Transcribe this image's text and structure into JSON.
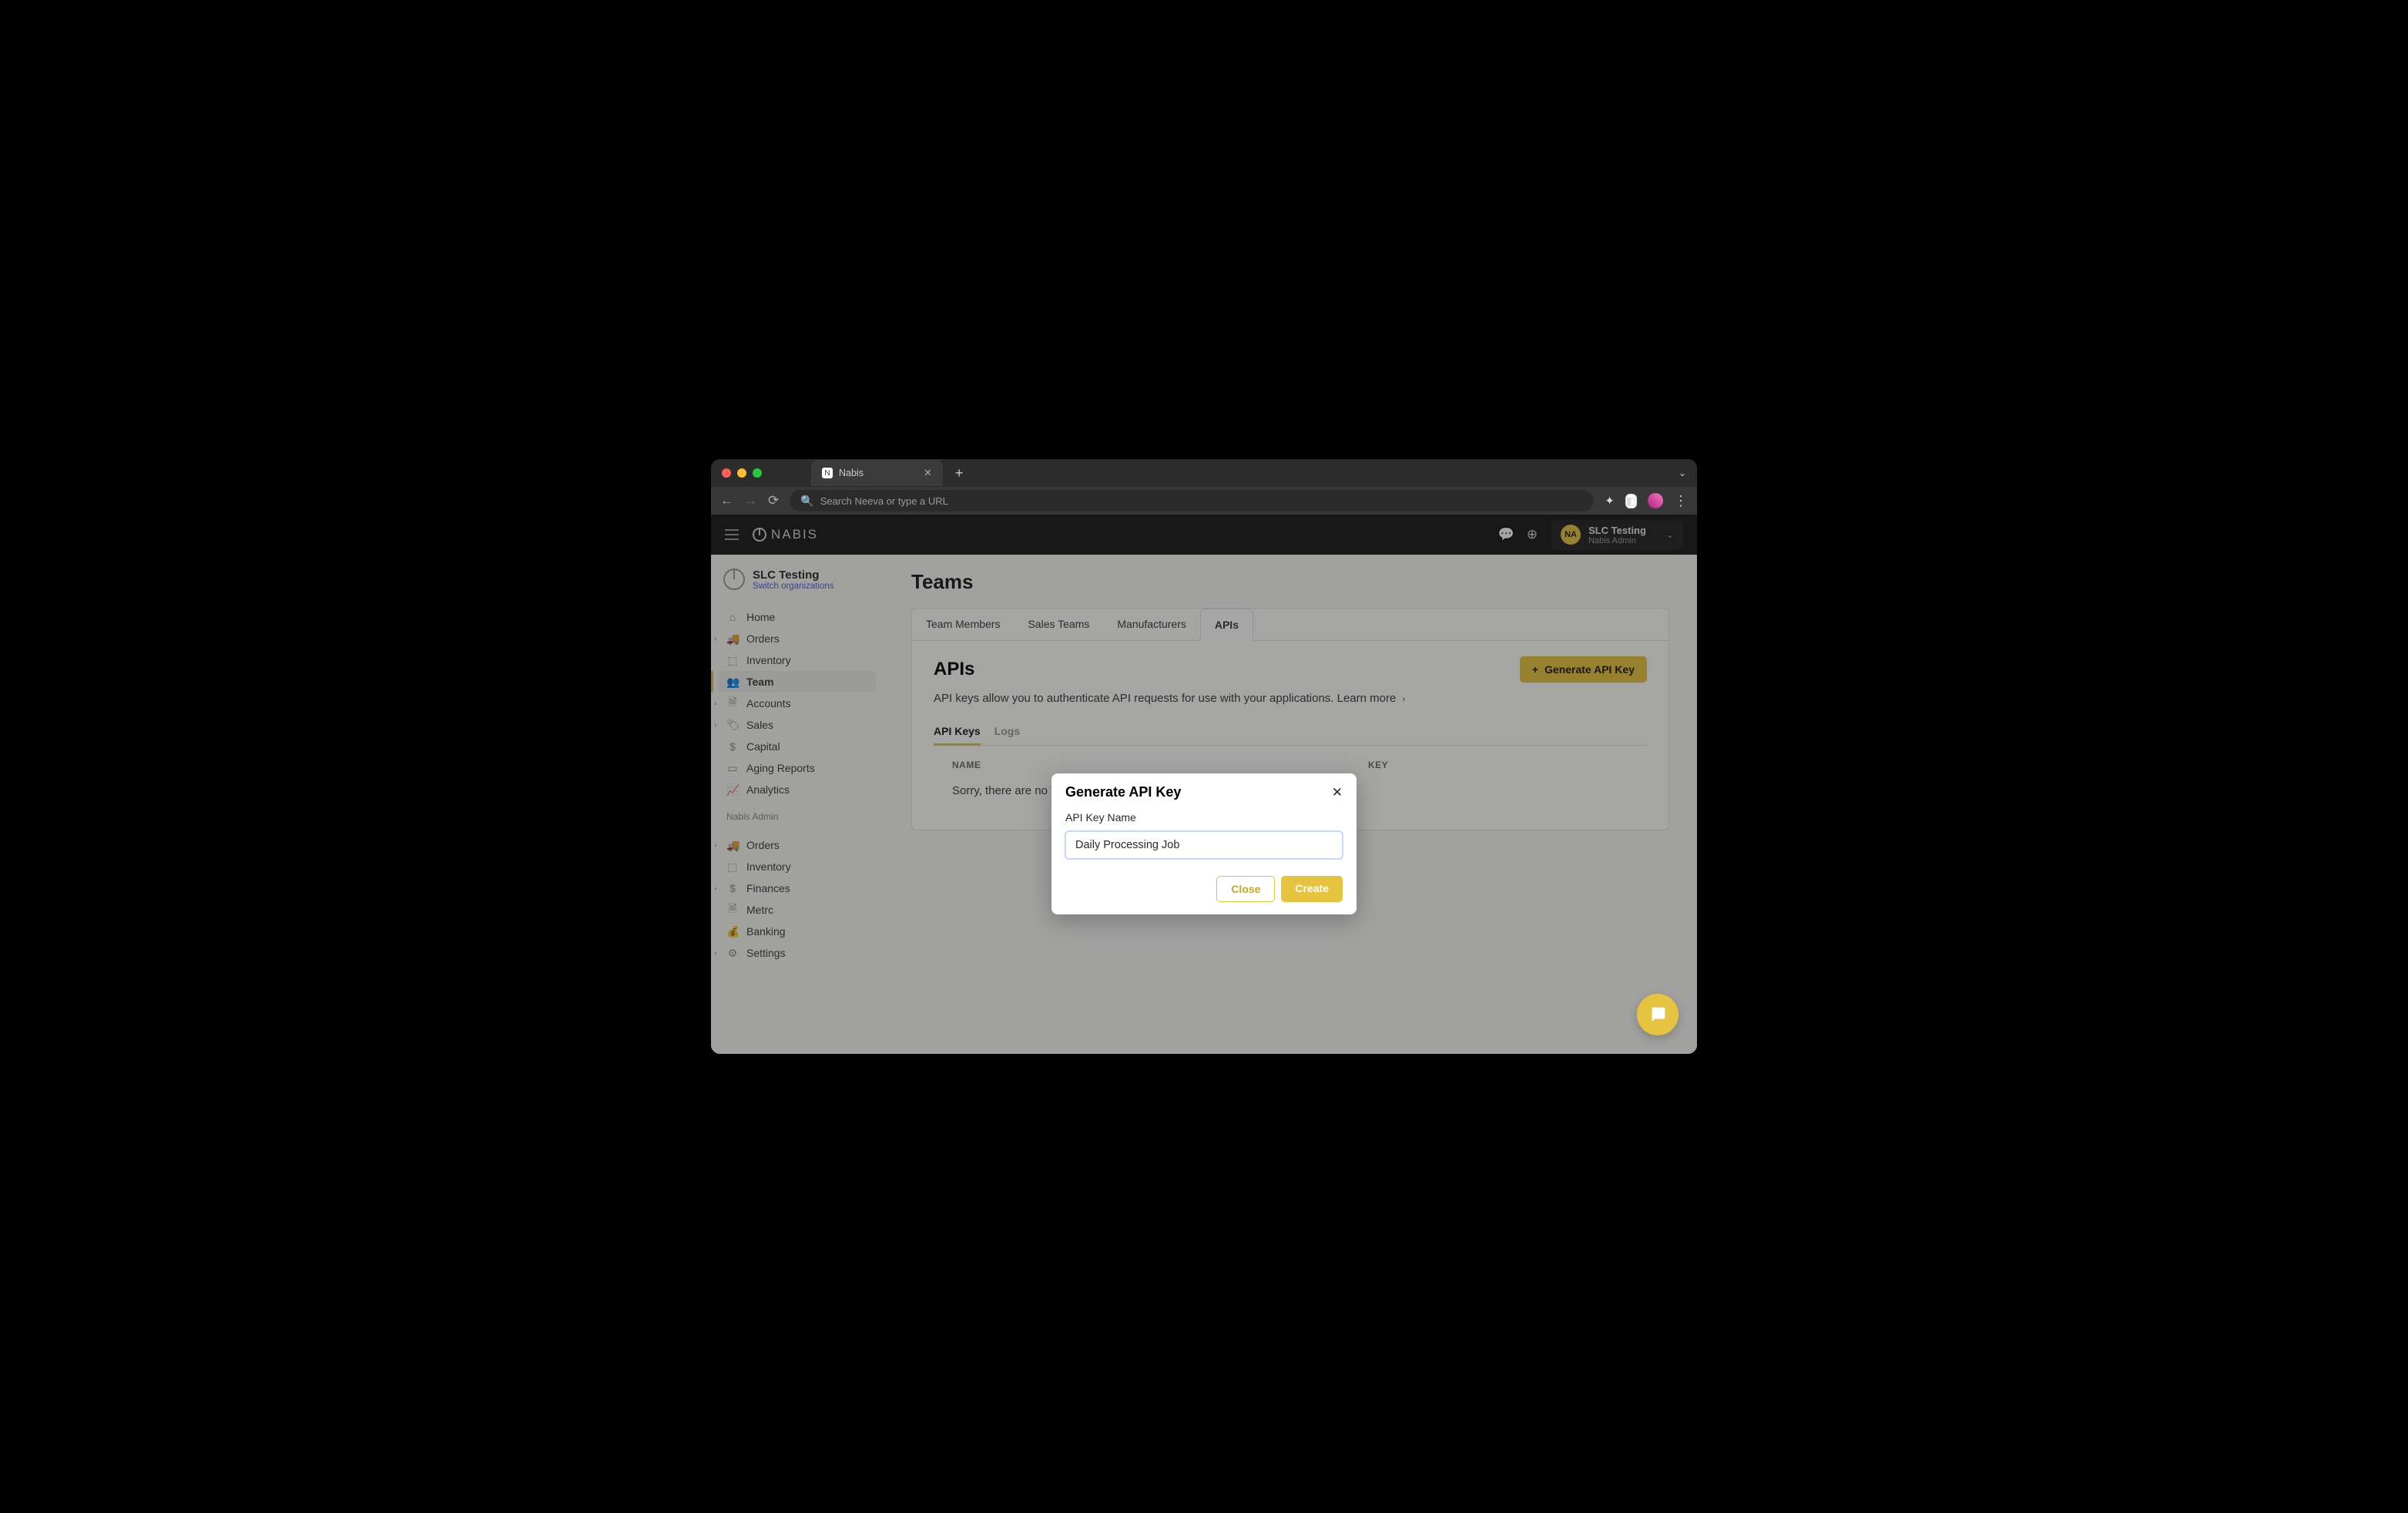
{
  "browser": {
    "tab_title": "Nabis",
    "search_placeholder": "Search Neeva or type a URL"
  },
  "topbar": {
    "brand": "NABIS",
    "user_avatar": "NA",
    "user_name": "SLC Testing",
    "user_role": "Nabis Admin"
  },
  "sidebar": {
    "org_name": "SLC Testing",
    "switch_label": "Switch organizations",
    "section1": [
      {
        "label": "Home",
        "icon": "⌂",
        "chevron": false
      },
      {
        "label": "Orders",
        "icon": "🚚",
        "chevron": true
      },
      {
        "label": "Inventory",
        "icon": "⬚",
        "chevron": false
      },
      {
        "label": "Team",
        "icon": "👥",
        "chevron": false,
        "active": true
      },
      {
        "label": "Accounts",
        "icon": "🗎",
        "chevron": true
      },
      {
        "label": "Sales",
        "icon": "🏷",
        "chevron": true
      },
      {
        "label": "Capital",
        "icon": "$",
        "chevron": false
      },
      {
        "label": "Aging Reports",
        "icon": "▭",
        "chevron": false
      },
      {
        "label": "Analytics",
        "icon": "📈",
        "chevron": false
      }
    ],
    "section2_title": "Nabis Admin",
    "section2": [
      {
        "label": "Orders",
        "icon": "🚚",
        "chevron": true
      },
      {
        "label": "Inventory",
        "icon": "⬚",
        "chevron": false
      },
      {
        "label": "Finances",
        "icon": "$",
        "chevron": true
      },
      {
        "label": "Metrc",
        "icon": "🗎",
        "chevron": false
      },
      {
        "label": "Banking",
        "icon": "💰",
        "chevron": false
      },
      {
        "label": "Settings",
        "icon": "⚙",
        "chevron": true
      }
    ]
  },
  "page": {
    "title": "Teams",
    "tabs": [
      "Team Members",
      "Sales Teams",
      "Manufacturers",
      "APIs"
    ],
    "active_tab": "APIs",
    "apis": {
      "heading": "APIs",
      "generate_btn": "Generate API Key",
      "description": "API keys allow you to authenticate API requests for use with your applications.",
      "learn_more": "Learn more",
      "subtabs": [
        "API Keys",
        "Logs"
      ],
      "active_subtab": "API Keys",
      "columns": {
        "name": "NAME",
        "key": "KEY"
      },
      "empty_message": "Sorry, there are no V2"
    }
  },
  "modal": {
    "title": "Generate API Key",
    "field_label": "API Key Name",
    "field_value": "Daily Processing Job",
    "close_btn": "Close",
    "create_btn": "Create"
  }
}
